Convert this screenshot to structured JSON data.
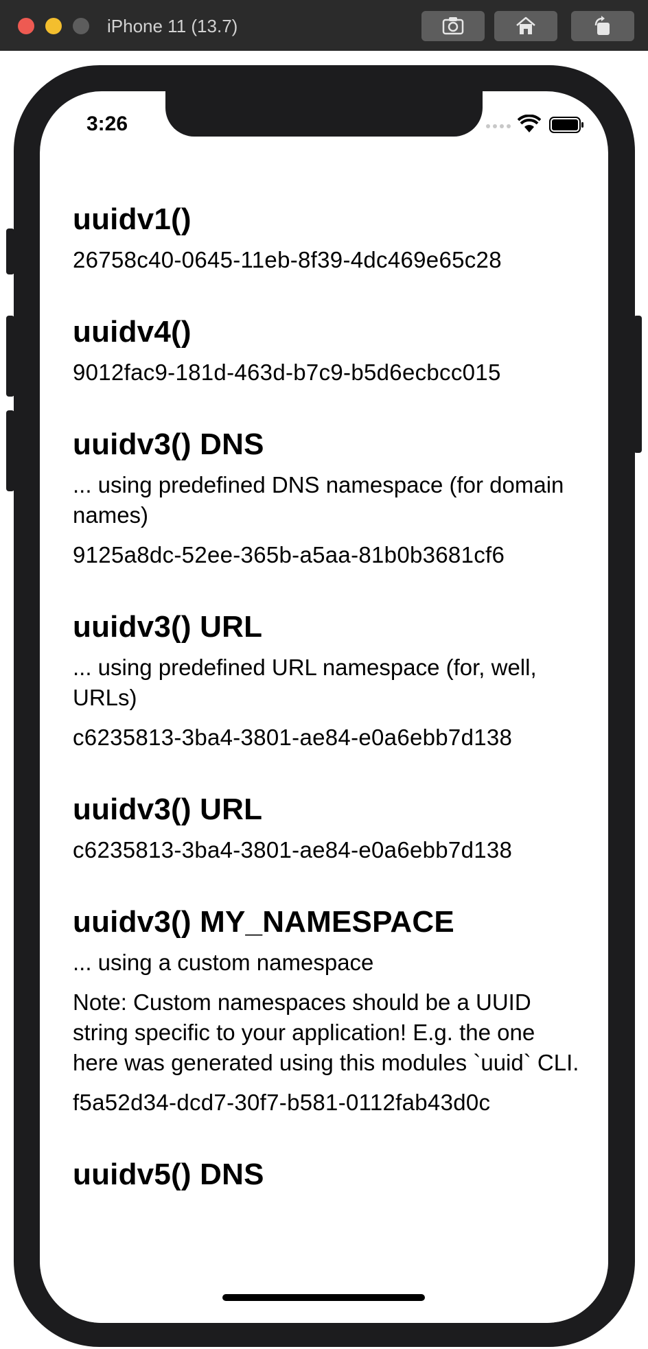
{
  "window": {
    "title": "iPhone 11 (13.7)",
    "buttons": [
      "screenshot-icon",
      "home-icon",
      "rotate-icon"
    ]
  },
  "status_bar": {
    "time": "3:26",
    "icons": [
      "signal-icon",
      "wifi-icon",
      "battery-icon"
    ]
  },
  "sections": [
    {
      "heading": "uuidv1()",
      "description": "",
      "note": "",
      "value": "26758c40-0645-11eb-8f39-4dc469e65c28"
    },
    {
      "heading": "uuidv4()",
      "description": "",
      "note": "",
      "value": "9012fac9-181d-463d-b7c9-b5d6ecbcc015"
    },
    {
      "heading": "uuidv3() DNS",
      "description": "... using predefined DNS namespace (for domain names)",
      "note": "",
      "value": "9125a8dc-52ee-365b-a5aa-81b0b3681cf6"
    },
    {
      "heading": "uuidv3() URL",
      "description": "... using predefined URL namespace (for, well, URLs)",
      "note": "",
      "value": "c6235813-3ba4-3801-ae84-e0a6ebb7d138"
    },
    {
      "heading": "uuidv3() URL",
      "description": "",
      "note": "",
      "value": "c6235813-3ba4-3801-ae84-e0a6ebb7d138"
    },
    {
      "heading": "uuidv3() MY_NAMESPACE",
      "description": "... using a custom namespace",
      "note": "Note: Custom namespaces should be a UUID string specific to your application! E.g. the one here was generated using this modules `uuid` CLI.",
      "value": "f5a52d34-dcd7-30f7-b581-0112fab43d0c"
    },
    {
      "heading": "uuidv5() DNS",
      "description": "",
      "note": "",
      "value": ""
    }
  ],
  "colors": {
    "titlebar": "#2b2b2b",
    "device_frame": "#1c1c1e",
    "close": "#ee5a52",
    "minimize": "#f3be2e",
    "text": "#000000"
  }
}
